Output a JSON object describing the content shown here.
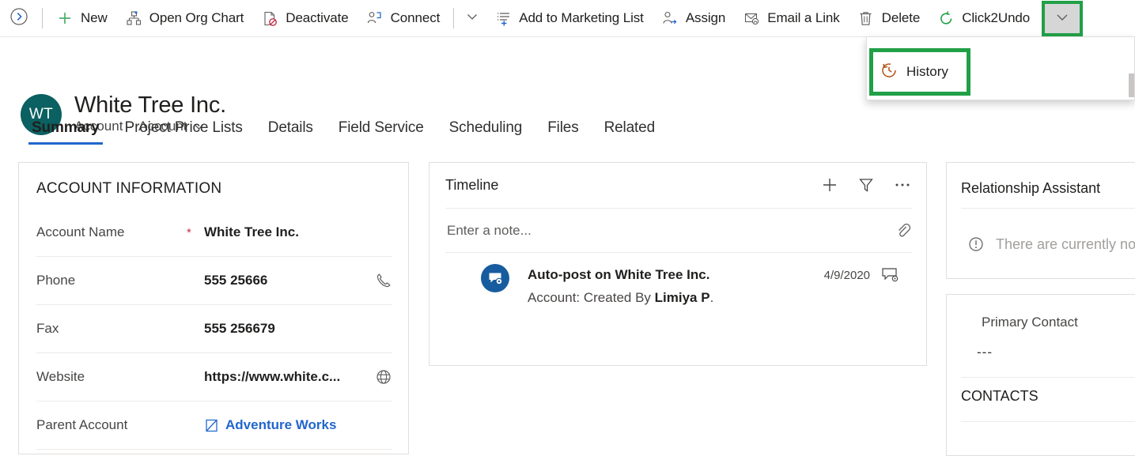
{
  "commandbar": {
    "expand_icon": "chevron-right-circle-icon",
    "buttons": [
      {
        "label": "New",
        "icon": "plus-icon"
      },
      {
        "label": "Open Org Chart",
        "icon": "org-chart-icon"
      },
      {
        "label": "Deactivate",
        "icon": "deactivate-document-icon"
      },
      {
        "label": "Connect",
        "icon": "connect-people-icon"
      }
    ],
    "overflow_chevron_mid": "chevron-down-icon",
    "buttons_after": [
      {
        "label": "Add to Marketing List",
        "icon": "add-to-list-icon"
      },
      {
        "label": "Assign",
        "icon": "assign-person-icon"
      },
      {
        "label": "Email a Link",
        "icon": "email-link-icon"
      },
      {
        "label": "Delete",
        "icon": "trash-icon"
      },
      {
        "label": "Click2Undo",
        "icon": "undo-circular-arrow-icon"
      }
    ],
    "overflow_chevron_last": "chevron-down-icon",
    "highlight_color": "#21a047",
    "undo_icon_color": "#21a047"
  },
  "flyout": {
    "items": [
      {
        "label": "History",
        "icon": "history-clock-icon"
      }
    ]
  },
  "record": {
    "avatar_initials": "WT",
    "avatar_color": "#0b6061",
    "title": "White Tree Inc.",
    "entity_type": "Account",
    "separator": "·",
    "form_name": "Account",
    "form_chevron": "chevron-down-icon"
  },
  "tabs": [
    {
      "label": "Summary",
      "active": true
    },
    {
      "label": "Project Price Lists",
      "active": false
    },
    {
      "label": "Details",
      "active": false
    },
    {
      "label": "Field Service",
      "active": false
    },
    {
      "label": "Scheduling",
      "active": false
    },
    {
      "label": "Files",
      "active": false
    },
    {
      "label": "Related",
      "active": false
    }
  ],
  "account_card": {
    "title": "ACCOUNT INFORMATION",
    "fields": [
      {
        "label": "Account Name",
        "required": "*",
        "value": "White Tree Inc.",
        "icon": "",
        "is_link": false
      },
      {
        "label": "Phone",
        "required": "",
        "value": "555 25666",
        "icon": "phone-icon",
        "is_link": false
      },
      {
        "label": "Fax",
        "required": "",
        "value": "555 256679",
        "icon": "",
        "is_link": false
      },
      {
        "label": "Website",
        "required": "",
        "value": "https://www.white.c...",
        "icon": "globe-icon",
        "is_link": false
      },
      {
        "label": "Parent Account",
        "required": "",
        "value": "Adventure Works",
        "icon": "record-lookup-icon",
        "is_link": true
      }
    ]
  },
  "timeline": {
    "title": "Timeline",
    "actions": [
      {
        "name": "add",
        "icon": "plus-icon"
      },
      {
        "name": "filter",
        "icon": "funnel-icon"
      },
      {
        "name": "more",
        "icon": "ellipsis-icon"
      }
    ],
    "note_placeholder": "Enter a note...",
    "attach_icon": "paperclip-icon",
    "entries": [
      {
        "icon": "post-settings-icon",
        "title": "Auto-post on White Tree Inc.",
        "subtitle_prefix": "Account: Created By ",
        "subtitle_bold": "Limiya P",
        "subtitle_suffix": ".",
        "date": "4/9/2020",
        "type_icon": "post-record-icon"
      }
    ]
  },
  "assistant": {
    "title": "Relationship Assistant",
    "empty_icon": "info-circle-icon",
    "empty_text": "There are currently no"
  },
  "contacts": {
    "primary_contact_label": "Primary Contact",
    "primary_contact_value": "---",
    "section_title": "CONTACTS"
  }
}
